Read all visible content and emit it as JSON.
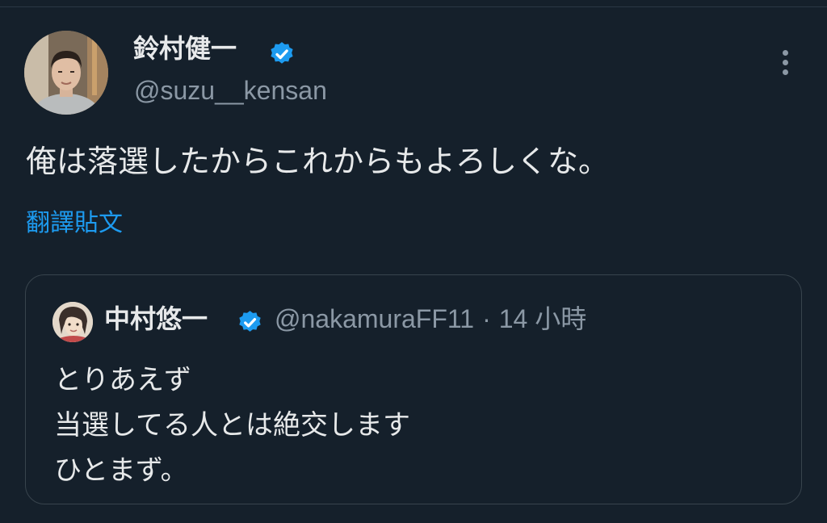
{
  "tweet": {
    "author": {
      "name": "鈴村健一",
      "handle": "@suzu__kensan",
      "verified": true
    },
    "text": "俺は落選したからこれからもよろしくな。",
    "translate_label": "翻譯貼文",
    "quote": {
      "author": {
        "name": "中村悠一",
        "handle": "@nakamuraFF11",
        "verified": true
      },
      "separator": "·",
      "time": "14 小時",
      "lines": [
        "とりあえず",
        "当選してる人とは絶交します",
        "ひとまず。"
      ]
    }
  },
  "icons": {
    "verified": "verified-badge-icon",
    "more": "more-vertical-icon"
  },
  "colors": {
    "background": "#15202b",
    "text_primary": "#e7e9ea",
    "text_secondary": "#8b98a5",
    "accent": "#1d9bf0",
    "border": "#38444d"
  }
}
